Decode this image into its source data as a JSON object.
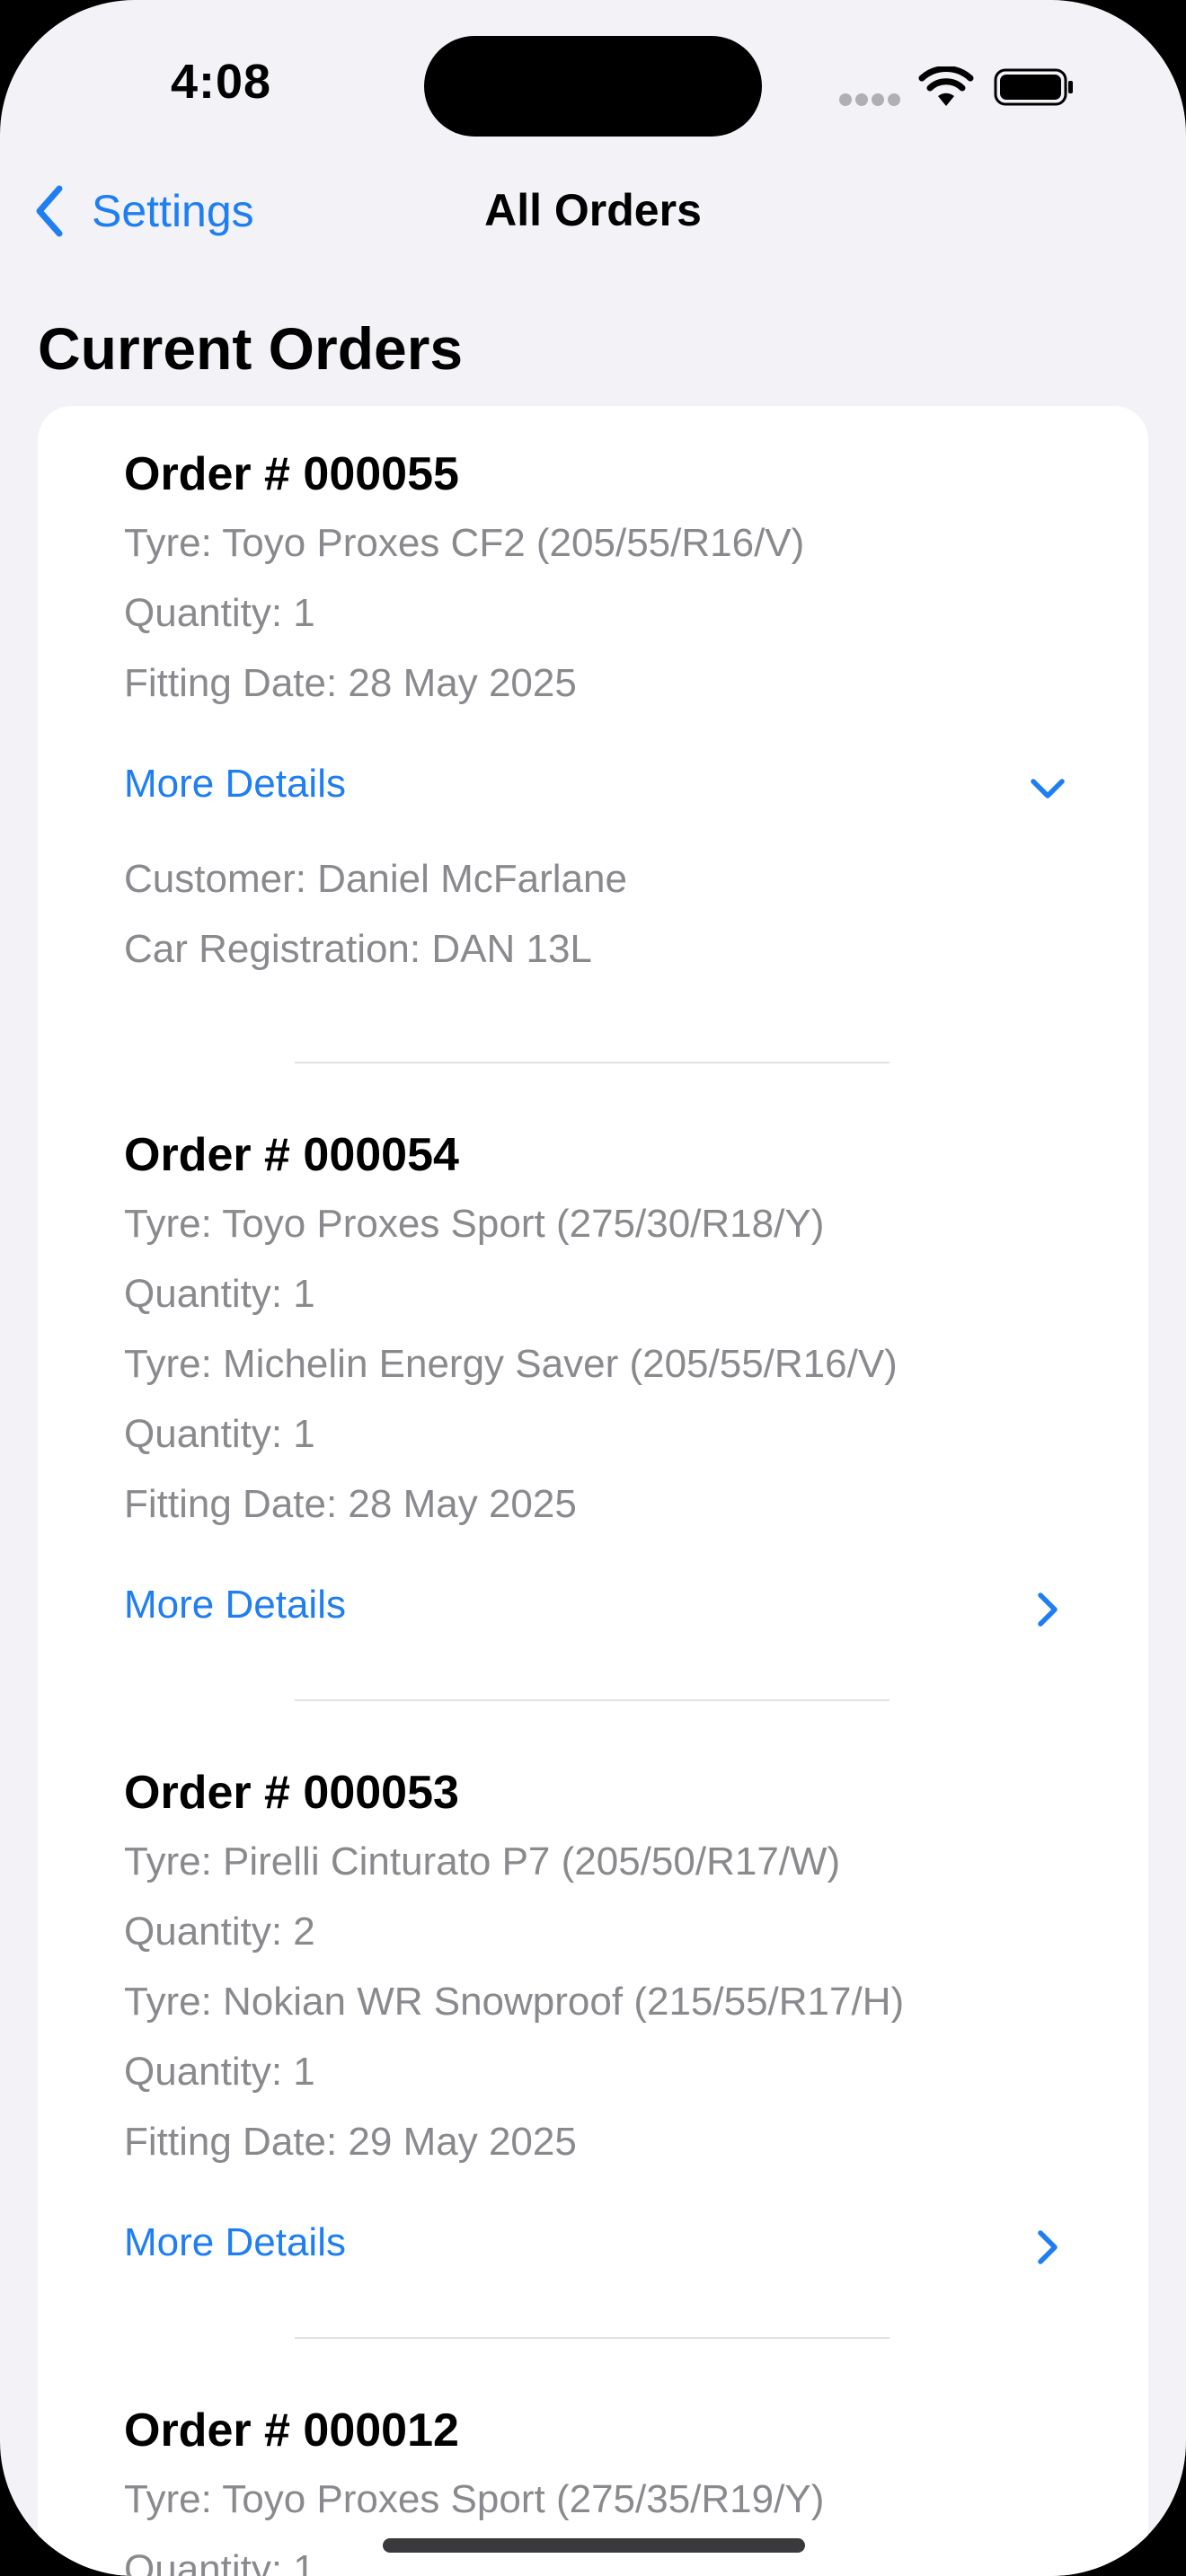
{
  "status_bar": {
    "time": "4:08"
  },
  "nav": {
    "back_label": "Settings",
    "title": "All Orders"
  },
  "section_title": "Current Orders",
  "orders": [
    {
      "title": "Order # 000055",
      "lines": [
        "Tyre: Toyo Proxes CF2 (205/55/R16/V)",
        "Quantity: 1",
        "Fitting Date: 28 May 2025"
      ],
      "more_label": "More Details",
      "expanded": true,
      "details": [
        "Customer: Daniel McFarlane",
        "Car Registration: DAN 13L"
      ]
    },
    {
      "title": "Order # 000054",
      "lines": [
        "Tyre: Toyo Proxes Sport (275/30/R18/Y)",
        "Quantity: 1",
        "Tyre: Michelin Energy Saver (205/55/R16/V)",
        "Quantity: 1",
        "Fitting Date: 28 May 2025"
      ],
      "more_label": "More Details",
      "expanded": false
    },
    {
      "title": "Order # 000053",
      "lines": [
        "Tyre: Pirelli Cinturato P7 (205/50/R17/W)",
        "Quantity: 2",
        "Tyre: Nokian WR Snowproof (215/55/R17/H)",
        "Quantity: 1",
        "Fitting Date: 29 May 2025"
      ],
      "more_label": "More Details",
      "expanded": false
    },
    {
      "title": "Order # 000012",
      "lines": [
        "Tyre: Toyo Proxes Sport (275/35/R19/Y)",
        "Quantity: 1"
      ]
    }
  ],
  "colors": {
    "accent": "#1e7ef2",
    "background": "#f2f2f7",
    "secondary_text": "#8a8a8e"
  },
  "icons": {
    "back": "chevron-left-icon",
    "expanded": "chevron-down-icon",
    "collapsed": "chevron-right-icon",
    "wifi": "wifi-icon",
    "battery": "battery-icon"
  }
}
